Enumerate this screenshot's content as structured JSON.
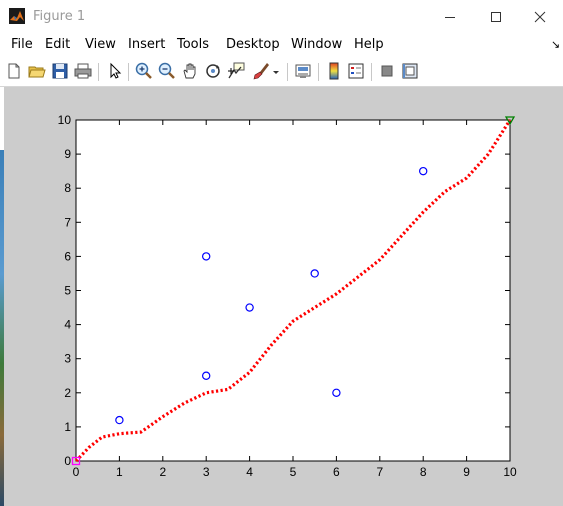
{
  "window": {
    "title": "Figure 1",
    "accent_color": "#d95319"
  },
  "menubar": {
    "items": [
      "File",
      "Edit",
      "View",
      "Insert",
      "Tools",
      "Desktop",
      "Window",
      "Help"
    ],
    "dock_arrow": "↘"
  },
  "toolbar": {
    "buttons": [
      "new-figure-icon",
      "open-file-icon",
      "save-figure-icon",
      "print-figure-icon",
      "edit-plot-arrow-icon",
      "zoom-in-icon",
      "zoom-out-icon",
      "pan-hand-icon",
      "rotate-3d-icon",
      "data-cursor-icon",
      "brush-icon",
      "link-plot-icon",
      "insert-colorbar-icon",
      "insert-legend-icon",
      "hide-plot-tools-icon",
      "show-plot-tools-icon"
    ]
  },
  "chart_data": {
    "type": "scatter",
    "title": "",
    "xlabel": "",
    "ylabel": "",
    "xlim": [
      0,
      10
    ],
    "ylim": [
      0,
      10
    ],
    "xticks": [
      0,
      1,
      2,
      3,
      4,
      5,
      6,
      7,
      8,
      9,
      10
    ],
    "yticks": [
      0,
      1,
      2,
      3,
      4,
      5,
      6,
      7,
      8,
      9,
      10
    ],
    "grid": false,
    "series": [
      {
        "marker": "circle",
        "color": "#0000ff",
        "x": [
          1,
          3,
          3,
          4,
          5.5,
          6,
          8
        ],
        "y": [
          1.2,
          2.5,
          6,
          4.5,
          5.5,
          2,
          8.5
        ]
      },
      {
        "line_style": "dotted",
        "color": "#ff0000",
        "x": [
          0,
          0.3,
          0.6,
          1,
          1.5,
          2,
          2.5,
          3,
          3.5,
          4,
          4.5,
          5,
          5.5,
          6,
          6.5,
          7,
          7.5,
          8,
          8.5,
          9,
          9.5,
          10
        ],
        "y": [
          0,
          0.4,
          0.7,
          0.8,
          0.85,
          1.3,
          1.7,
          2,
          2.1,
          2.6,
          3.4,
          4.1,
          4.5,
          4.9,
          5.4,
          5.9,
          6.6,
          7.3,
          7.9,
          8.3,
          9,
          10
        ]
      },
      {
        "marker": "square",
        "color": "#ff00ff",
        "x": [
          0
        ],
        "y": [
          0
        ]
      },
      {
        "marker": "triangle-down",
        "color": "#008000",
        "x": [
          10
        ],
        "y": [
          10
        ]
      }
    ]
  }
}
